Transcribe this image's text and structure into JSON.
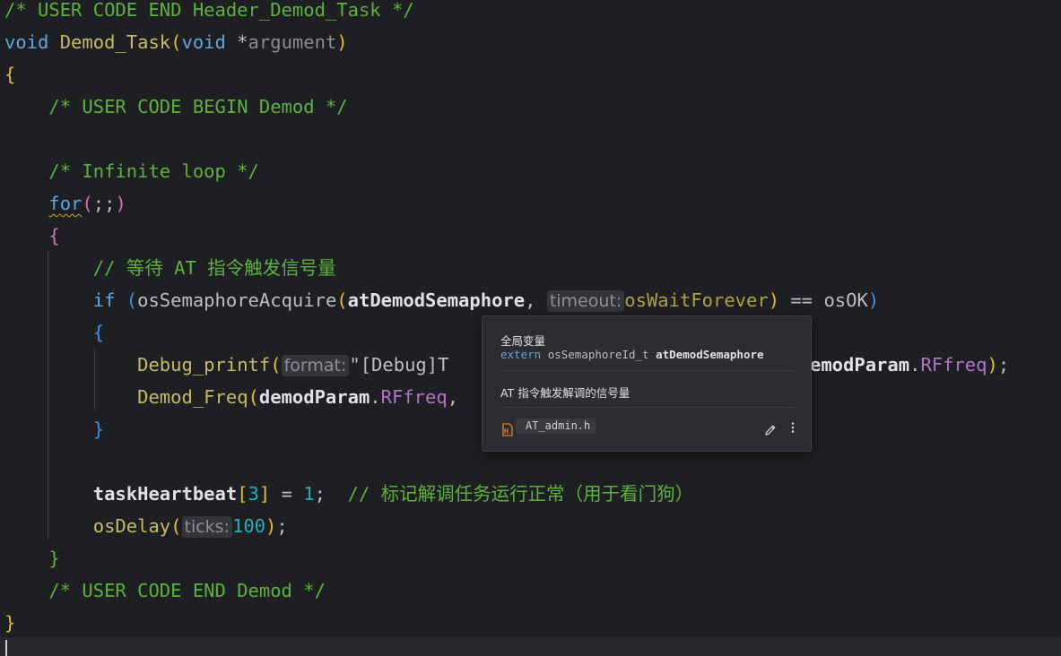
{
  "code": {
    "l1": "/* USER CODE END Header_Demod_Task */",
    "l2_kw": "void",
    "l2_fn": "Demod_Task",
    "l2_kw2": "void",
    "l2_ptr": "*",
    "l2_param": "argument",
    "l4": "/* USER CODE BEGIN Demod */",
    "l6": "/* Infinite loop */",
    "l7_kw": "for",
    "l7_rest": ";;",
    "l9": "// 等待 AT 指令触发信号量",
    "l10_kw": "if",
    "l10_fn": "osSemaphoreAcquire",
    "l10_arg": "atDemodSemaphore",
    "l10_hint": "timeout:",
    "l10_mac": "osWaitForever",
    "l10_op": " == ",
    "l10_ok": "osOK",
    "l12_fn": "Debug_printf",
    "l12_hint": "format:",
    "l12_str": "\"[Debug]T",
    "l12_tail_var": "emodParam",
    "l12_tail_fld": "RFfreq",
    "l13_fn": "Demod_Freq",
    "l13_var": "demodParam",
    "l13_fld": "RFfreq",
    "l16_var": "taskHeartbeat",
    "l16_idx": "3",
    "l16_eq": " = ",
    "l16_val": "1",
    "l16_cm": "// 标记解调任务运行正常（用于看门狗）",
    "l17_fn": "osDelay",
    "l17_hint": "ticks:",
    "l17_val": "100",
    "l19": "/* USER CODE END Demod */"
  },
  "popup": {
    "kind": "全局变量",
    "decl_kw": "extern",
    "decl_type": "osSemaphoreId_t",
    "decl_name": "atDemodSemaphore",
    "description": "AT 指令触发解调的信号量",
    "file": "AT_admin.h",
    "edit_icon": "pencil-icon",
    "more_icon": "vertical-ellipsis-icon",
    "file_icon": "header-file-icon"
  },
  "colors": {
    "background": "#1e1f22",
    "comment": "#5fb040",
    "keyword": "#5ea7dc",
    "function": "#c7b96a",
    "field": "#b573c8",
    "popup_bg": "#2b2d30"
  }
}
